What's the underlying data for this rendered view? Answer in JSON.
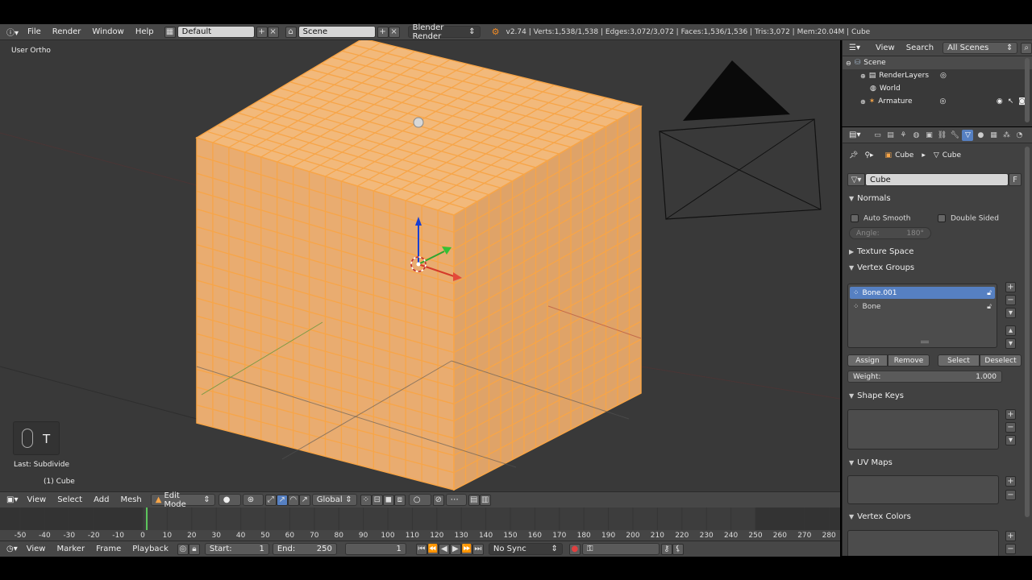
{
  "info_header": {
    "menus": [
      "File",
      "Render",
      "Window",
      "Help"
    ],
    "layout": "Default",
    "scene": "Scene",
    "engine": "Blender Render",
    "stats": "v2.74 | Verts:1,538/1,538 | Edges:3,072/3,072 | Faces:1,536/1,536 | Tris:3,072 | Mem:20.04M | Cube"
  },
  "viewport": {
    "view_label": "User Ortho",
    "last_op": "Last: Subdivide",
    "object_label": "(1) Cube",
    "tool_hint": "T"
  },
  "view_header": {
    "menus": [
      "View",
      "Select",
      "Add",
      "Mesh"
    ],
    "mode": "Edit Mode",
    "orientation": "Global"
  },
  "timeline": {
    "ticks": [
      "-50",
      "-40",
      "-30",
      "-20",
      "-10",
      "0",
      "10",
      "20",
      "30",
      "40",
      "50",
      "60",
      "70",
      "80",
      "90",
      "100",
      "110",
      "120",
      "130",
      "140",
      "150",
      "160",
      "170",
      "180",
      "190",
      "200",
      "210",
      "220",
      "230",
      "240",
      "250",
      "260",
      "270",
      "280"
    ],
    "menus": [
      "View",
      "Marker",
      "Frame",
      "Playback"
    ],
    "start_label": "Start:",
    "start": "1",
    "end_label": "End:",
    "end": "250",
    "current": "1",
    "sync": "No Sync"
  },
  "outliner": {
    "menus": [
      "View",
      "Search"
    ],
    "filter": "All Scenes",
    "items": [
      "Scene",
      "RenderLayers",
      "World",
      "Armature"
    ]
  },
  "properties": {
    "breadcrumb": [
      "Cube",
      "Cube"
    ],
    "mesh_name": "Cube",
    "fake_user": "F",
    "normals": {
      "title": "Normals",
      "auto_smooth": "Auto Smooth",
      "double_sided": "Double Sided",
      "angle_label": "Angle:",
      "angle_value": "180°"
    },
    "texture_space": "Texture Space",
    "vertex_groups": {
      "title": "Vertex Groups",
      "items": [
        "Bone.001",
        "Bone"
      ],
      "assign": "Assign",
      "remove": "Remove",
      "select": "Select",
      "deselect": "Deselect",
      "weight_label": "Weight:",
      "weight_value": "1.000"
    },
    "shape_keys": "Shape Keys",
    "uv_maps": "UV Maps",
    "vertex_colors": "Vertex Colors"
  },
  "colors": {
    "selection_orange": "#f7a548",
    "active_blue": "#5680c2",
    "viewport_bg": "#393939"
  }
}
